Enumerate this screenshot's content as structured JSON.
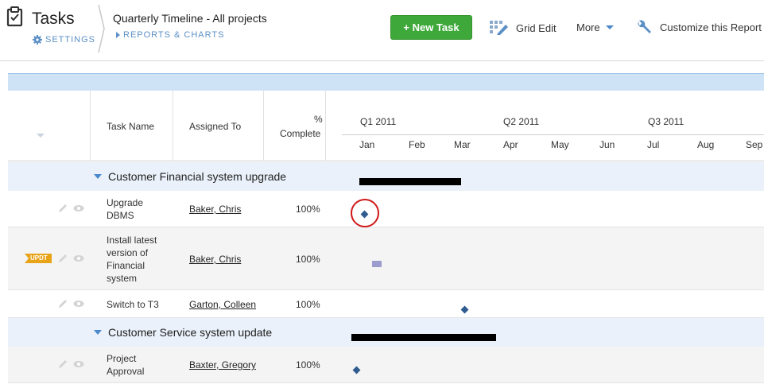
{
  "header": {
    "app_title": "Tasks",
    "settings_label": "SETTINGS",
    "report_title": "Quarterly Timeline - All projects",
    "reports_link": "REPORTS & CHARTS",
    "new_task_label": "+ New Task",
    "grid_edit_label": "Grid Edit",
    "more_label": "More",
    "customize_label": "Customize this Report"
  },
  "columns": {
    "task_name": "Task Name",
    "assigned_to": "Assigned To",
    "pct_line1": "%",
    "pct_line2": "Complete"
  },
  "timeline": {
    "quarters": [
      "Q1 2011",
      "Q2 2011",
      "Q3 2011"
    ],
    "months": [
      "Jan",
      "Feb",
      "Mar",
      "Apr",
      "May",
      "Jun",
      "Jul",
      "Aug",
      "Sep"
    ]
  },
  "groups": [
    {
      "label": "Customer Financial system upgrade",
      "tasks": [
        {
          "name": "Upgrade DBMS",
          "assignee": "Baker, Chris",
          "percent": "100%",
          "badge": ""
        },
        {
          "name": "Install latest version of Financial system",
          "assignee": "Baker, Chris",
          "percent": "100%",
          "badge": "UPDT"
        },
        {
          "name": "Switch to T3",
          "assignee": "Garton, Colleen",
          "percent": "100%",
          "badge": ""
        }
      ]
    },
    {
      "label": "Customer Service system update",
      "tasks": [
        {
          "name": "Project Approval",
          "assignee": "Baxter, Gregory",
          "percent": "100%",
          "badge": ""
        }
      ]
    }
  ],
  "colors": {
    "accent_blue": "#5b8fc6",
    "new_task_green": "#3fa83b",
    "milestone": "#2f5b8f",
    "task_bar": "#9b9ccd",
    "badge": "#e8a316",
    "highlight_circle": "#d01919"
  },
  "icons": [
    "clipboard-icon",
    "gear-icon",
    "grid-edit-icon",
    "wrench-icon",
    "pencil-icon",
    "eye-icon"
  ]
}
